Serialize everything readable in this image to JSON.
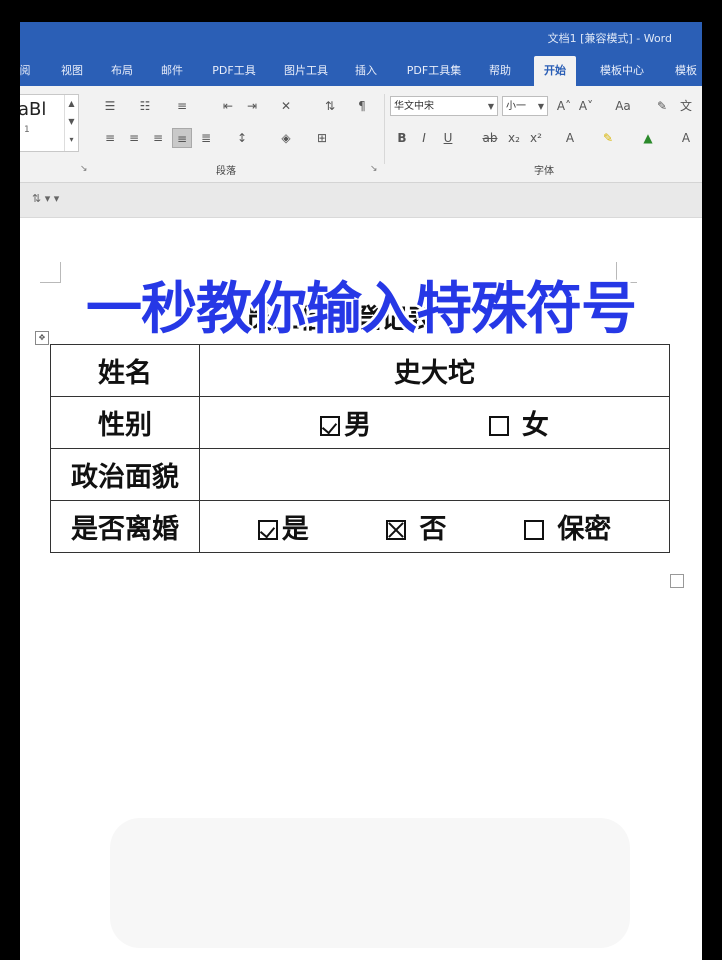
{
  "window": {
    "title": "文档1 [兼容模式] - Word"
  },
  "ribbon_tabs": [
    {
      "label": "阅"
    },
    {
      "label": "视图"
    },
    {
      "label": "布局"
    },
    {
      "label": "邮件"
    },
    {
      "label": "PDF工具"
    },
    {
      "label": "图片工具"
    },
    {
      "label": "插入"
    },
    {
      "label": "PDF工具集"
    },
    {
      "label": "帮助"
    },
    {
      "label": "开始"
    },
    {
      "label": "模板中心"
    },
    {
      "label": "模板"
    }
  ],
  "active_tab": "开始",
  "styles": {
    "sample": "aBl",
    "index": "1"
  },
  "ribbon_groups": {
    "paragraph": "段落",
    "font": "字体"
  },
  "font": {
    "name": "华文中宋",
    "size": "小一"
  },
  "document": {
    "title": "员工信息登记表",
    "rows": [
      {
        "label": "姓名",
        "value": "史大坨"
      },
      {
        "label": "性别",
        "options": [
          {
            "box": "tick",
            "text": "男"
          },
          {
            "box": "empty",
            "text": "女"
          }
        ]
      },
      {
        "label": "政治面貌",
        "value": ""
      },
      {
        "label": "是否离婚",
        "options": [
          {
            "box": "tick",
            "text": "是"
          },
          {
            "box": "cross",
            "text": "否"
          },
          {
            "box": "empty",
            "text": "保密"
          }
        ]
      }
    ]
  },
  "overlay_caption": "一秒教你输入特殊符号",
  "colors": {
    "title_bar": "#2b5fb6",
    "overlay_text": "#2638e6"
  }
}
